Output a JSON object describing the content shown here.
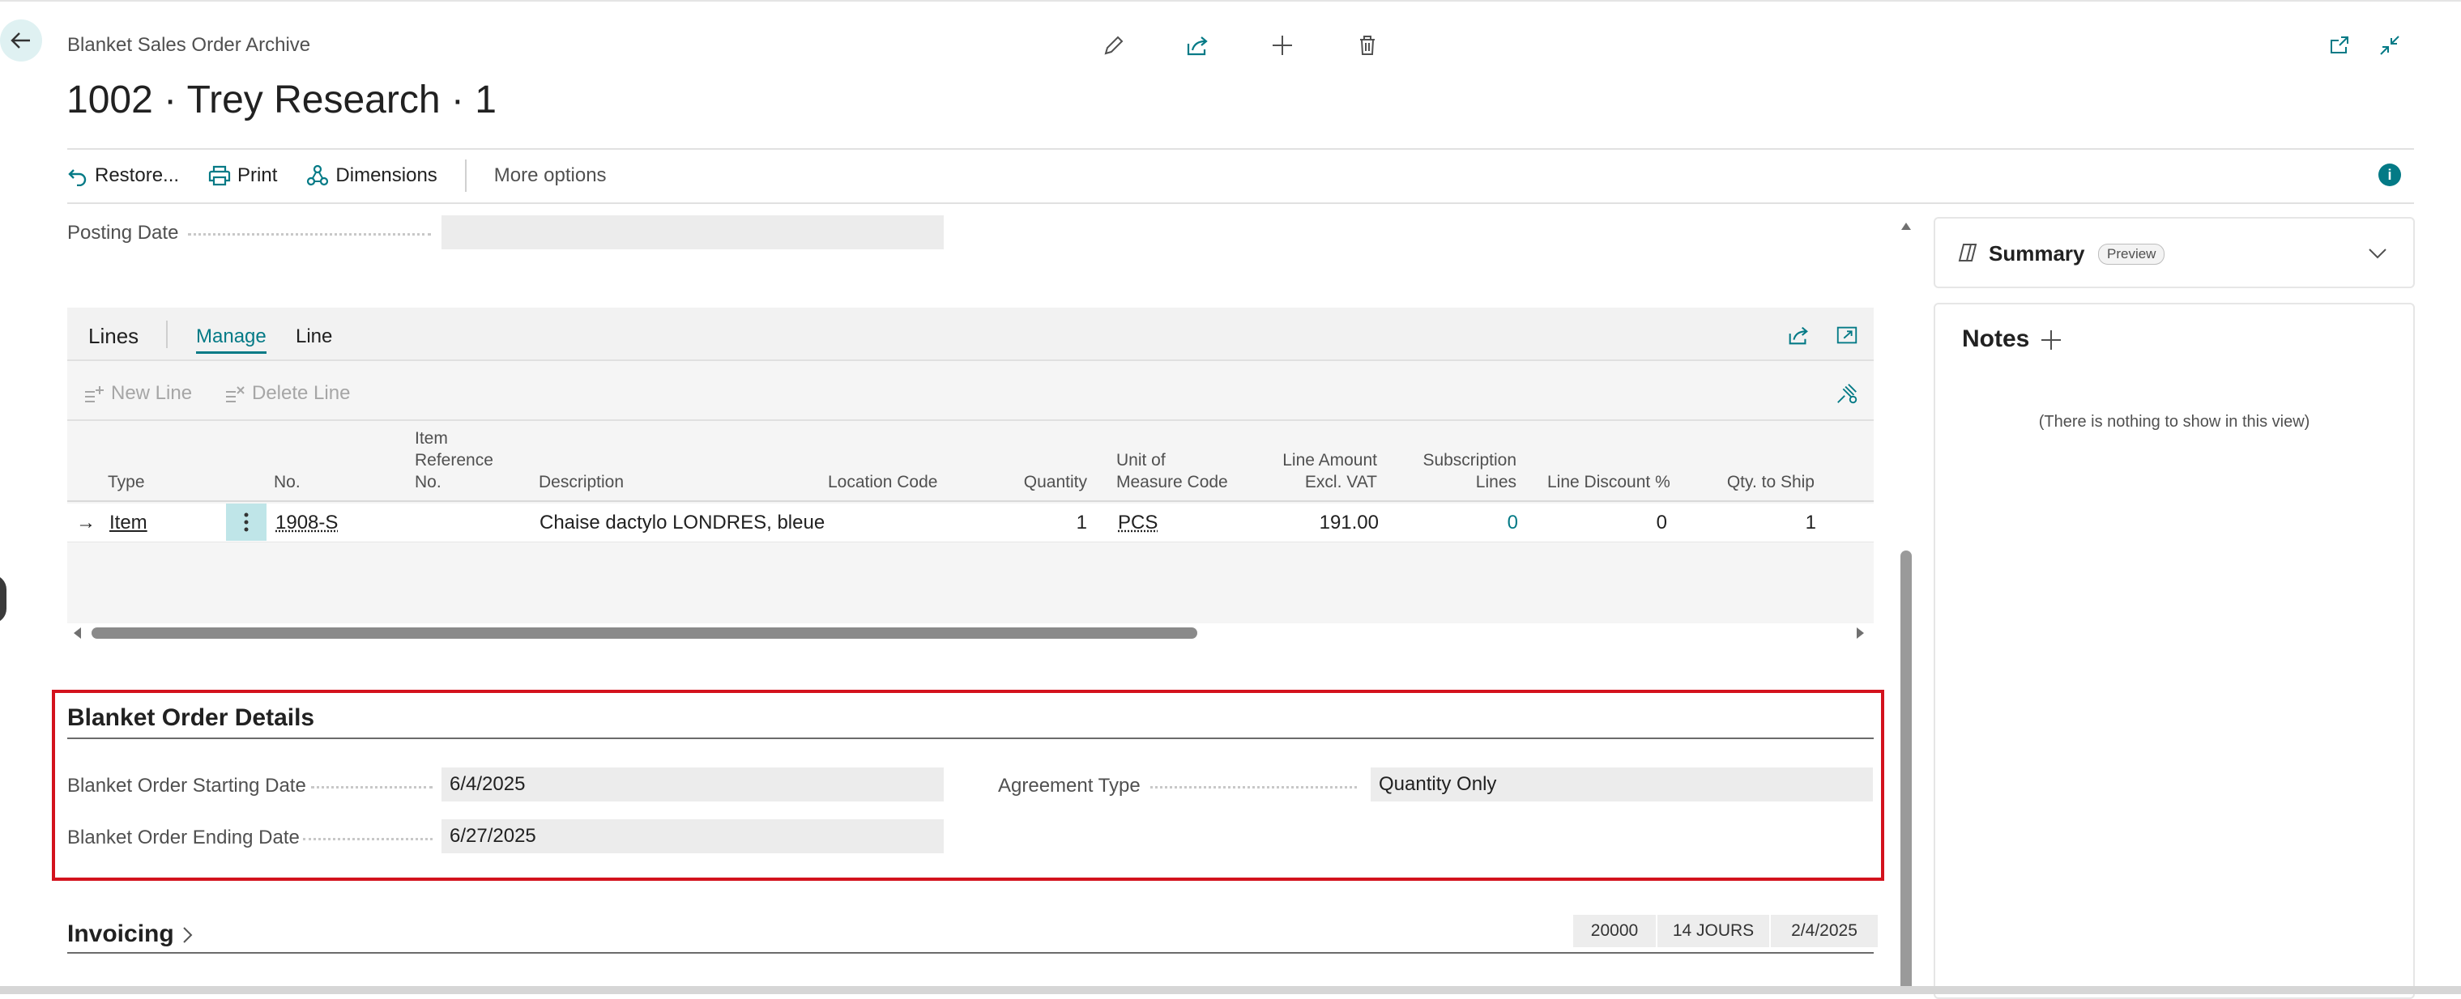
{
  "header": {
    "breadcrumb": "Blanket Sales Order Archive",
    "title": "1002 · Trey Research · 1"
  },
  "actions": {
    "restore": "Restore...",
    "print": "Print",
    "dimensions": "Dimensions",
    "more": "More options"
  },
  "general": {
    "posting_date_label": "Posting Date",
    "posting_date_value": ""
  },
  "lines": {
    "title": "Lines",
    "tab_manage": "Manage",
    "tab_line": "Line",
    "new_line": "New Line",
    "delete_line": "Delete Line",
    "columns": {
      "type": "Type",
      "no": "No.",
      "item_ref_1": "Item",
      "item_ref_2": "Reference",
      "item_ref_3": "No.",
      "description": "Description",
      "location": "Location Code",
      "quantity": "Quantity",
      "uom_1": "Unit of",
      "uom_2": "Measure Code",
      "amount_1": "Line Amount",
      "amount_2": "Excl. VAT",
      "subs_1": "Subscription",
      "subs_2": "Lines",
      "discount": "Line Discount %",
      "qty_ship": "Qty. to Ship"
    },
    "row": {
      "arrow": "→",
      "type": "Item",
      "no": "1908-S",
      "description": "Chaise dactylo LONDRES, bleue",
      "quantity": "1",
      "uom": "PCS",
      "amount": "191.00",
      "subs": "0",
      "discount": "0",
      "qty_ship": "1"
    }
  },
  "blanket": {
    "title": "Blanket Order Details",
    "start_label": "Blanket Order Starting Date",
    "start_value": "6/4/2025",
    "end_label": "Blanket Order Ending Date",
    "end_value": "6/27/2025",
    "agreement_label": "Agreement Type",
    "agreement_value": "Quantity Only"
  },
  "invoicing": {
    "title": "Invoicing",
    "badges": [
      "20000",
      "14 JOURS",
      "2/4/2025"
    ]
  },
  "factbox": {
    "summary_title": "Summary",
    "summary_badge": "Preview",
    "notes_title": "Notes",
    "notes_empty": "(There is nothing to show in this view)"
  },
  "colors": {
    "accent": "#047a86",
    "highlight_border": "#d3121d"
  }
}
